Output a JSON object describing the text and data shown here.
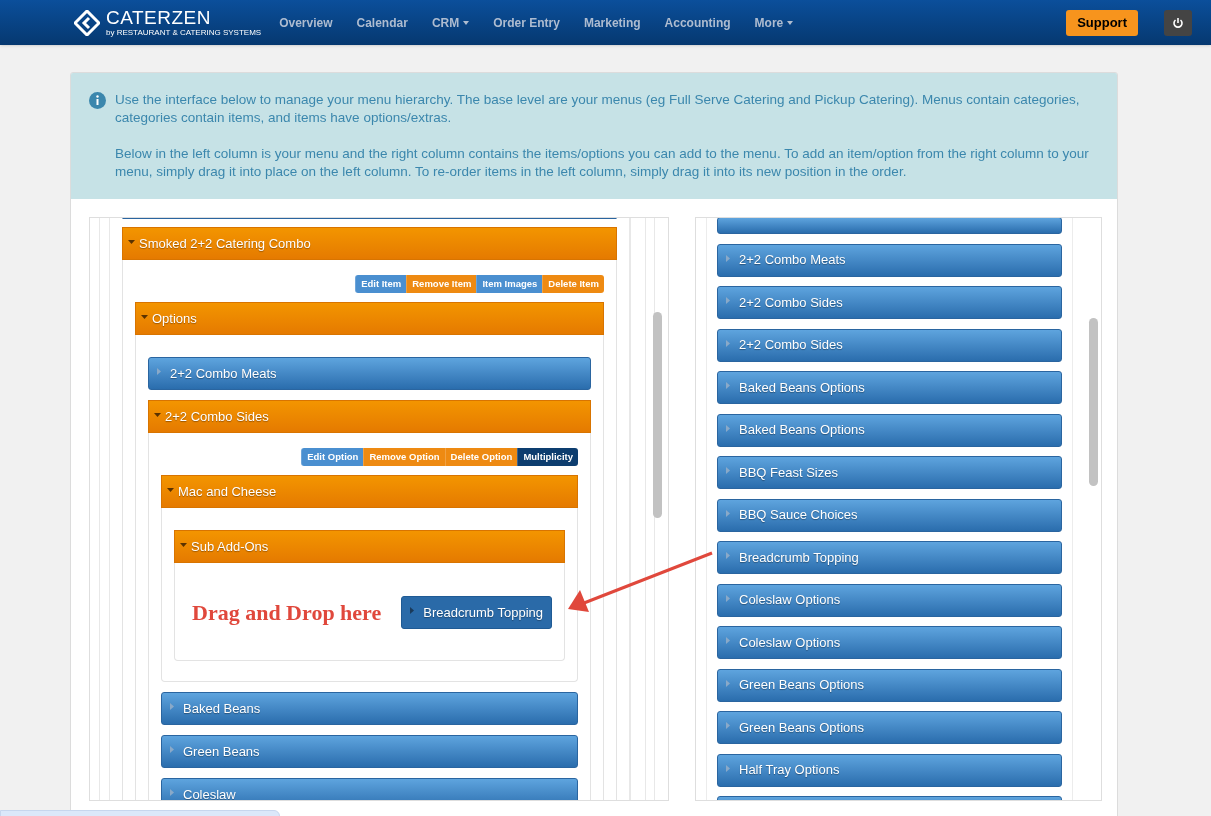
{
  "nav": {
    "logo": "CATERZEN",
    "logo_sub": "by RESTAURANT & CATERING SYSTEMS",
    "items": [
      {
        "label": "Overview",
        "dropdown": false
      },
      {
        "label": "Calendar",
        "dropdown": false
      },
      {
        "label": "CRM",
        "dropdown": true
      },
      {
        "label": "Order Entry",
        "dropdown": false
      },
      {
        "label": "Marketing",
        "dropdown": false
      },
      {
        "label": "Accounting",
        "dropdown": false
      },
      {
        "label": "More",
        "dropdown": true
      }
    ],
    "support": "Support"
  },
  "info": [
    "Use the interface below to manage your menu hierarchy. The base level are your menus (eg Full Serve Catering and Pickup Catering). Menus contain categories, categories contain items, and items have options/extras.",
    "Below in the left column is your menu and the right column contains the items/options you can add to the menu. To add an item/option from the right column to your menu, simply drag it into place on the left column. To re-order items in the left column, simply drag it into its new position in the order."
  ],
  "menu_tree": [
    {
      "label": "Smoked 2+2 Catering Combo",
      "expanded": true,
      "actions": [
        {
          "label": "Edit Item",
          "kind": "blue"
        },
        {
          "label": "Remove Item",
          "kind": "orange"
        },
        {
          "label": "Item Images",
          "kind": "blue"
        },
        {
          "label": "Delete Item",
          "kind": "orange"
        }
      ],
      "children": [
        {
          "label": "Options",
          "expanded": true,
          "children": [
            {
              "label": "2+2 Combo Meats",
              "expanded": false
            },
            {
              "label": "2+2 Combo Sides",
              "expanded": true,
              "actions": [
                {
                  "label": "Edit Option",
                  "kind": "blue"
                },
                {
                  "label": "Remove Option",
                  "kind": "orange"
                },
                {
                  "label": "Delete Option",
                  "kind": "orange"
                },
                {
                  "label": "Multiplicity",
                  "kind": "dark"
                }
              ],
              "children": [
                {
                  "label": "Mac and Cheese",
                  "expanded": true,
                  "children": [
                    {
                      "label": "Sub Add-Ons",
                      "expanded": true,
                      "drop_hint": "Drag and Drop here",
                      "children": [
                        {
                          "label": "Breadcrumb Topping",
                          "expanded": false,
                          "kind": "dropped"
                        }
                      ]
                    }
                  ]
                },
                {
                  "label": "Baked Beans",
                  "expanded": false
                },
                {
                  "label": "Green Beans",
                  "expanded": false
                },
                {
                  "label": "Coleslaw",
                  "expanded": false
                }
              ]
            }
          ]
        }
      ]
    }
  ],
  "library": [
    "2+2 Combo Meats",
    "2+2 Combo Sides",
    "2+2 Combo Sides",
    "Baked Beans Options",
    "Baked Beans Options",
    "BBQ Feast Sizes",
    "BBQ Sauce Choices",
    "Breadcrumb Topping",
    "Coleslaw Options",
    "Coleslaw Options",
    "Green Beans Options",
    "Green Beans Options",
    "Half Tray Options"
  ]
}
